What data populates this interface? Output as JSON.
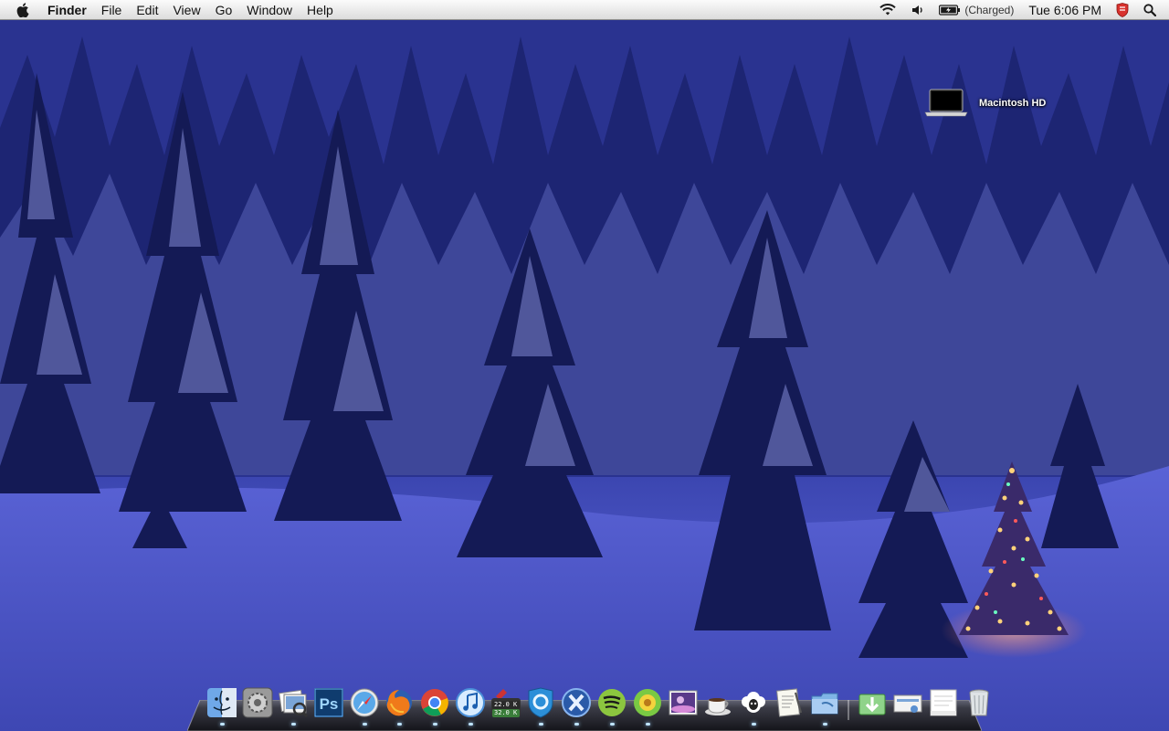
{
  "menubar": {
    "apple_icon": "apple-logo-icon",
    "app_name": "Finder",
    "menus": [
      "File",
      "Edit",
      "View",
      "Go",
      "Window",
      "Help"
    ],
    "status": {
      "wifi_icon": "wifi-icon",
      "volume_icon": "volume-icon",
      "battery_icon": "battery-icon",
      "battery_text": "(Charged)",
      "clock": "Tue 6:06 PM",
      "shield_icon": "shield-icon",
      "spotlight_icon": "spotlight-search-icon"
    }
  },
  "desktop": {
    "icons": [
      {
        "label": "Macintosh HD",
        "icon": "macbook-drive-icon"
      }
    ]
  },
  "dock": {
    "apps": [
      {
        "icon": "finder-icon",
        "running": true
      },
      {
        "icon": "system-preferences-icon",
        "running": false
      },
      {
        "icon": "preview-icon",
        "running": true
      },
      {
        "icon": "photoshop-icon",
        "text": "Ps",
        "running": false
      },
      {
        "icon": "safari-icon",
        "running": true
      },
      {
        "icon": "firefox-icon",
        "running": true
      },
      {
        "icon": "chrome-icon",
        "running": true
      },
      {
        "icon": "itunes-icon",
        "running": true
      },
      {
        "icon": "network-meter-icon",
        "upload": "22.0 K",
        "download": "32.0 K",
        "running": false
      },
      {
        "icon": "shield-app-icon",
        "running": true
      },
      {
        "icon": "x11-icon",
        "running": true
      },
      {
        "icon": "spotify-icon",
        "running": true
      },
      {
        "icon": "sunflower-app-icon",
        "running": true
      },
      {
        "icon": "photo-booth-icon",
        "running": false
      },
      {
        "icon": "coffee-cup-icon",
        "running": false
      },
      {
        "icon": "sheep-icon",
        "running": true
      },
      {
        "icon": "script-editor-icon",
        "running": false
      },
      {
        "icon": "folder-app-icon",
        "running": true
      }
    ],
    "stacks": [
      {
        "icon": "downloads-stack-icon"
      },
      {
        "icon": "documents-stack-icon"
      },
      {
        "icon": "note-stack-icon"
      },
      {
        "icon": "trash-icon"
      }
    ]
  },
  "colors": {
    "sky": "#232c6e",
    "snow": "#4e57c8",
    "menubar": "#e8e8e8"
  }
}
